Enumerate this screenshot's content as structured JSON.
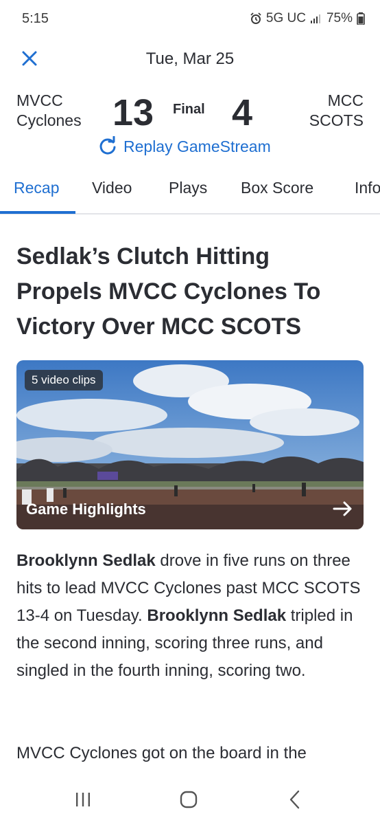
{
  "status": {
    "time": "5:15",
    "network": "5G UC",
    "battery": "75%"
  },
  "header": {
    "date": "Tue, Mar 25"
  },
  "scoreboard": {
    "home": {
      "line1": "MVCC",
      "line2": "Cyclones",
      "score": "13"
    },
    "away": {
      "line1": "MCC",
      "line2": "SCOTS",
      "score": "4"
    },
    "status": "Final",
    "replay_label": "Replay GameStream"
  },
  "tabs": [
    {
      "label": "Recap"
    },
    {
      "label": "Video"
    },
    {
      "label": "Plays"
    },
    {
      "label": "Box Score"
    },
    {
      "label": "Info"
    }
  ],
  "article": {
    "headline": "Sedlak’s Clutch Hitting Propels MVCC Cyclones To Victory Over MCC SCOTS",
    "video": {
      "badge": "5 video clips",
      "title": "Game Highlights"
    },
    "p1_bold1": "Brooklynn Sedlak",
    "p1_text1": " drove in five runs on three hits to lead MVCC Cyclones past MCC SCOTS 13-4 on Tuesday. ",
    "p1_bold2": "Brooklynn Sedlak",
    "p1_text2": " tripled in the second inning, scoring three runs, and singled in the fourth inning, scoring two.",
    "p2_text": "MVCC Cyclones got on the board in the"
  },
  "colors": {
    "accent": "#1f6fd1",
    "text": "#2b2d33"
  },
  "icons": [
    "close-icon",
    "replay-icon",
    "arrow-right-icon",
    "alarm-icon",
    "signal-icon",
    "battery-icon"
  ]
}
